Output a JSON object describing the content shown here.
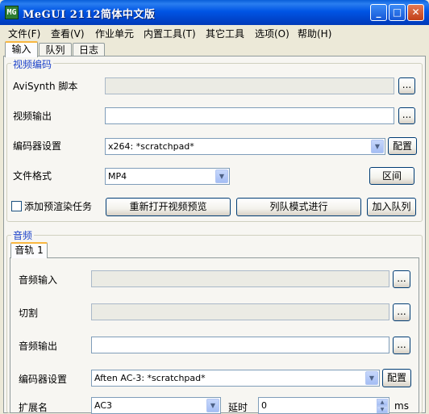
{
  "window": {
    "icon_text": "MG",
    "title": "MeGUI 2112简体中文版",
    "min_glyph": "_",
    "max_glyph": "□",
    "close_glyph": "✕"
  },
  "menu": [
    "文件(F)",
    "查看(V)",
    "作业单元",
    "内置工具(T)",
    "其它工具",
    "选项(O)",
    "帮助(H)"
  ],
  "tabs": [
    "输入",
    "队列",
    "日志"
  ],
  "video": {
    "group_title": "视频编码",
    "avisynth_label": "AviSynth 脚本",
    "avisynth_value": "",
    "output_label": "视频输出",
    "output_value": "",
    "encoder_label": "编码器设置",
    "encoder_value": "x264: *scratchpad*",
    "config_button": "配置",
    "format_label": "文件格式",
    "format_value": "MP4",
    "range_button": "区间",
    "prerender_label": "添加预渲染任务",
    "reopen_preview_button": "重新打开视频预览",
    "queue_mode_button": "列队模式进行",
    "add_queue_button": "加入队列",
    "browse_label": "..."
  },
  "audio": {
    "group_title": "音频",
    "track_tab": "音轨 1",
    "input_label": "音频输入",
    "input_value": "",
    "cut_label": "切割",
    "cut_value": "",
    "output_label": "音频输出",
    "output_value": "",
    "encoder_label": "编码器设置",
    "encoder_value": "Aften AC-3: *scratchpad*",
    "config_button": "配置",
    "ext_label": "扩展名",
    "ext_value": "AC3",
    "delay_label": "延时",
    "delay_value": "0",
    "delay_unit": "ms",
    "browse_label": "..."
  },
  "icons": {
    "combo_arrow": "▼",
    "spin_up": "▲",
    "spin_down": "▼"
  }
}
